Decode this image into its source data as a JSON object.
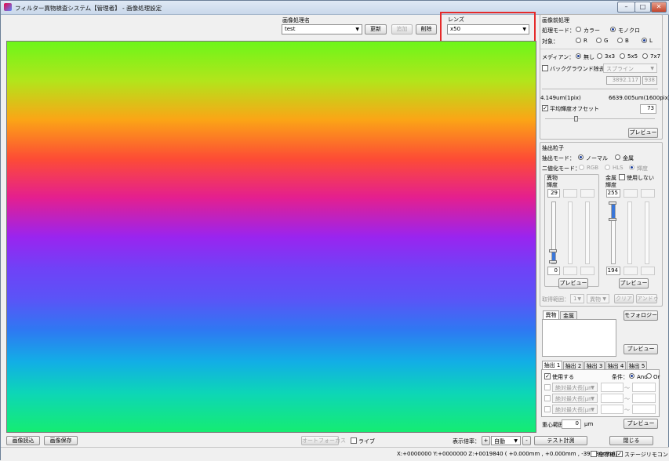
{
  "window": {
    "title": "フィルター異物検査システム【管理者】 - 画像処理設定"
  },
  "top": {
    "recipe_label": "画像処理名",
    "recipe_value": "test",
    "update": "更新",
    "add": "追加",
    "delete": "削除",
    "lens_label": "レンズ",
    "lens_value": "x50"
  },
  "pre": {
    "title": "画像前処理",
    "mode_label": "処理モード：",
    "color": "カラー",
    "mono": "モノクロ",
    "target_label": "対象：",
    "targets": [
      "R",
      "G",
      "B",
      "L"
    ],
    "median_label": "メディアン：",
    "medians": [
      "無し",
      "3x3",
      "5x5",
      "7x7"
    ],
    "bg_label": "バックグラウンド除去",
    "bg_method": "スプライン",
    "bg_v1": "3892.117",
    "bg_v2": "938",
    "range_min": "4.149um(1pix)",
    "range_max": "6639.005um(1600pix)",
    "offset_label": "平均輝度オフセット",
    "offset_value": "73",
    "preview": "プレビュー"
  },
  "extract": {
    "title": "抽出粒子",
    "mode_label": "抽出モード：",
    "normal": "ノーマル",
    "metal": "金属",
    "bin_label": "二値化モード：",
    "rgb": "RGB",
    "hls": "HLS",
    "lum": "輝度",
    "foreign_title": "異物",
    "foreign_sub": "輝度",
    "f_top": "29",
    "f_bottom": "0",
    "metal_title": "金属",
    "metal_sub": "輝度",
    "not_use": "使用しない",
    "m_top": "255",
    "m_bottom": "194",
    "preview": "プレビュー",
    "range_label": "取得範囲：",
    "range_v": "1",
    "range_t": "異物",
    "clear": "クリア",
    "undo": "アンドゥ"
  },
  "morph": {
    "tab_foreign": "異物",
    "tab_metal": "金属",
    "morph_btn": "モフォロジー",
    "preview": "プレビュー"
  },
  "conds": {
    "tabs": [
      "抽出 1",
      "抽出 2",
      "抽出 3",
      "抽出 4",
      "抽出 5"
    ],
    "use_label": "使用する",
    "cond_label": "条件：",
    "and": "And",
    "or": "Or",
    "rows": [
      "絶対最大長[μm",
      "絶対最大長[μm",
      "絶対最大長[μm",
      "絶対最大長[μm"
    ],
    "tilde": "～",
    "center_label": "重心範囲：",
    "center_value": "0",
    "center_unit": "μm",
    "preview": "プレビュー"
  },
  "bottom": {
    "load": "画像読込",
    "save": "画像保存",
    "autofocus": "オートフォーカス",
    "live": "ライブ",
    "zoom_label": "表示倍率：",
    "zoom_plus": "+",
    "zoom_value": "自動",
    "zoom_minus": "-",
    "test": "テスト計測",
    "close": "閉じる"
  },
  "status": {
    "coords": "X:+0000000  Y:+0000000  Z:+0019840 ( +0.000mm , +0.000mm , -39.680mm)",
    "coord_fix": "座標補正",
    "stage": "ステージリモコン"
  }
}
